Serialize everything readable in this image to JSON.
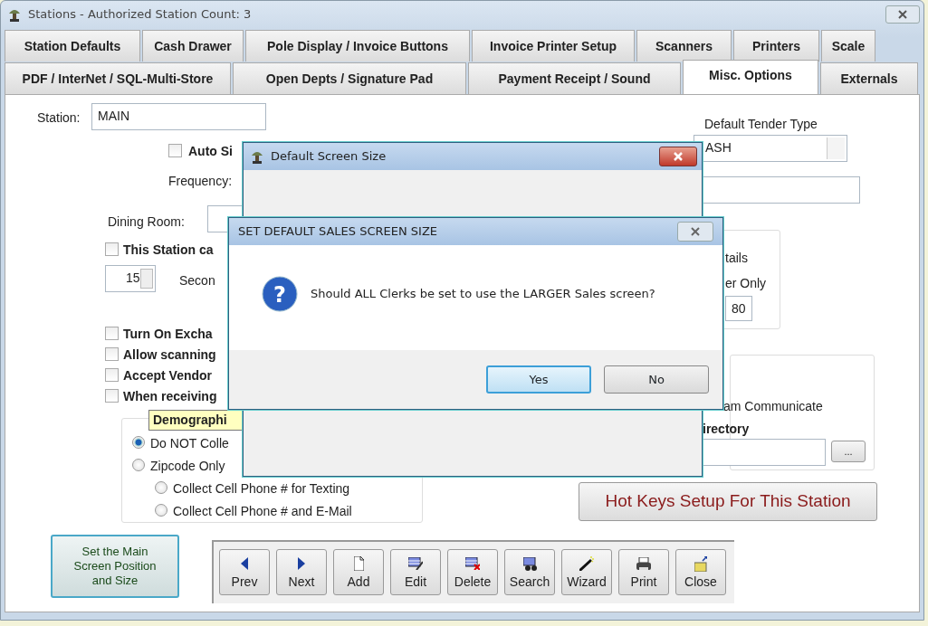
{
  "window": {
    "title": "Stations - Authorized Station Count: 3"
  },
  "tabs_row_1": [
    {
      "label": "Station Defaults",
      "selected": false
    },
    {
      "label": "Cash Drawer",
      "selected": false
    },
    {
      "label": "Pole Display / Invoice Buttons",
      "selected": false
    },
    {
      "label": "Invoice Printer Setup",
      "selected": false
    },
    {
      "label": "Scanners",
      "selected": false
    },
    {
      "label": "Printers",
      "selected": false
    },
    {
      "label": "Scale",
      "selected": false
    }
  ],
  "tabs_row_2": [
    {
      "label": "PDF / InterNet / SQL-Multi-Store",
      "selected": false
    },
    {
      "label": "Open Depts / Signature Pad",
      "selected": false
    },
    {
      "label": "Payment Receipt / Sound",
      "selected": false
    },
    {
      "label": "Misc. Options",
      "selected": true
    },
    {
      "label": "Externals",
      "selected": false
    }
  ],
  "station": {
    "label": "Station:",
    "value": "MAIN"
  },
  "auto_sign": {
    "label": "Auto Si",
    "checked": false
  },
  "frequency_label": "Frequency:",
  "dining_room_label": "Dining Room:",
  "this_station": {
    "label": "This Station ca",
    "checked": false
  },
  "seconds": {
    "value": "15",
    "label": "Secon"
  },
  "options": [
    {
      "label": "Turn On Excha",
      "checked": false
    },
    {
      "label": "Allow scanning",
      "checked": false
    },
    {
      "label": "Accept Vendor",
      "checked": false
    },
    {
      "label": "When receiving",
      "checked": false
    }
  ],
  "demographics": {
    "title": "Demographi",
    "choices": [
      {
        "label": "Do NOT Colle",
        "selected": true
      },
      {
        "label": "Zipcode Only",
        "selected": false,
        "children": [
          {
            "label": "Collect Cell Phone # for Texting",
            "selected": false
          },
          {
            "label": "Collect Cell Phone # and E-Mail",
            "selected": false
          }
        ]
      }
    ]
  },
  "set_main_screen_button": {
    "label": "Set the Main Screen Position and Size"
  },
  "toolbar": [
    {
      "kind": "prev",
      "label": "Prev"
    },
    {
      "kind": "next",
      "label": "Next"
    },
    {
      "kind": "add",
      "label": "Add"
    },
    {
      "kind": "edit",
      "label": "Edit"
    },
    {
      "kind": "delete",
      "label": "Delete"
    },
    {
      "kind": "search",
      "label": "Search"
    },
    {
      "kind": "wizard",
      "label": "Wizard"
    },
    {
      "kind": "print",
      "label": "Print"
    },
    {
      "kind": "close",
      "label": "Close"
    }
  ],
  "default_tender": {
    "label": "Default Tender Type",
    "value": "ASH"
  },
  "details_group": {
    "line_1": "tails",
    "line_2": "er Only",
    "value": "80"
  },
  "communicate_group": {
    "line_1": "am Communicate",
    "directory_label": "irectory",
    "browse": "..."
  },
  "hot_keys_button": {
    "label": "Hot Keys Setup For This Station"
  },
  "default_screen_dialog": {
    "title": "Default Screen Size"
  },
  "sales_screen_dialog": {
    "title": "SET DEFAULT SALES SCREEN SIZE",
    "icon_glyph": "?",
    "message": "Should ALL Clerks be set to use the LARGER Sales screen?",
    "buttons": [
      {
        "label": "Yes",
        "default": true
      },
      {
        "label": "No",
        "default": false
      }
    ]
  }
}
